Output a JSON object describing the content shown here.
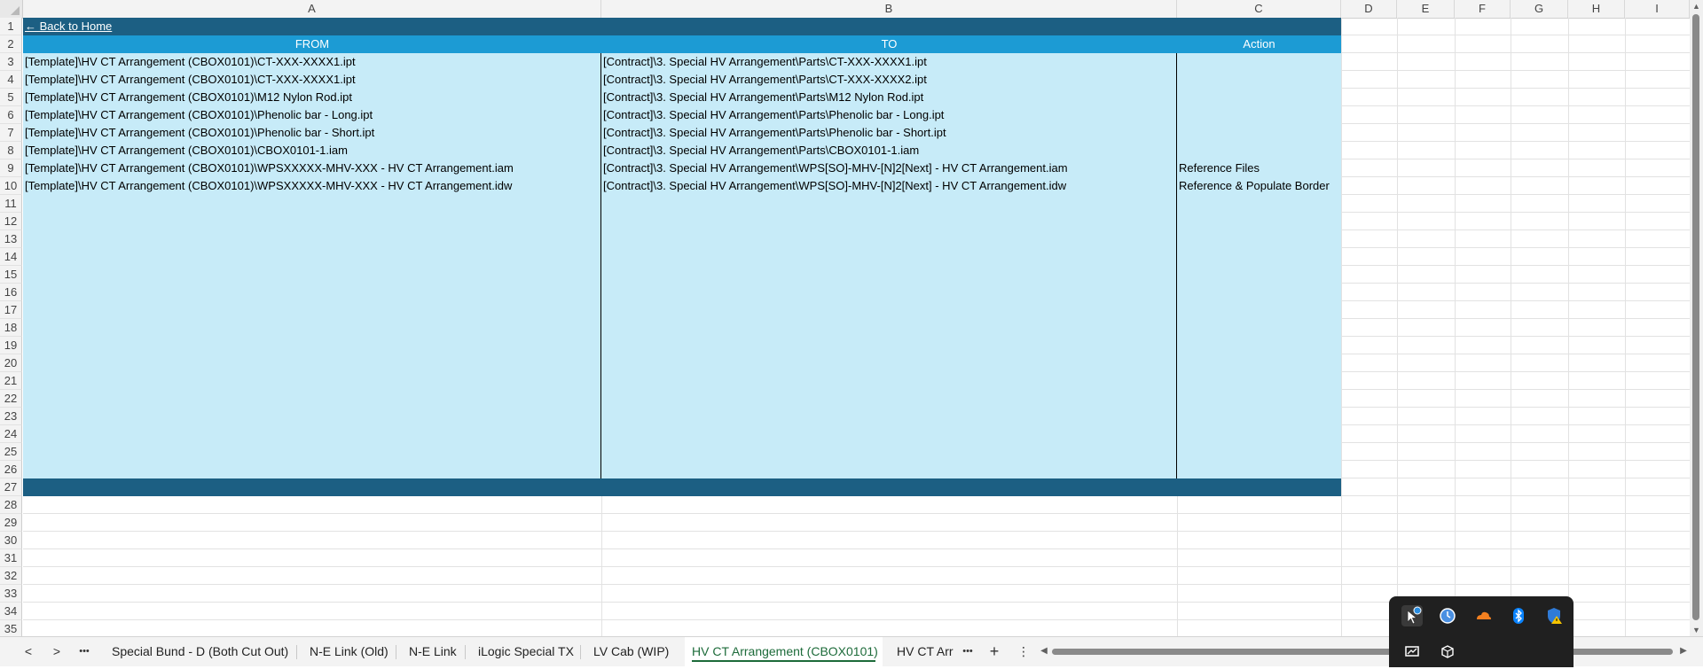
{
  "columns": [
    "A",
    "B",
    "C",
    "D",
    "E",
    "F",
    "G",
    "H",
    "I"
  ],
  "rows": [
    "1",
    "2",
    "3",
    "4",
    "5",
    "6",
    "7",
    "8",
    "9",
    "10",
    "11",
    "12",
    "13",
    "14",
    "15",
    "16",
    "17",
    "18",
    "19",
    "20",
    "21",
    "22",
    "23",
    "24",
    "25",
    "26",
    "27",
    "28",
    "29",
    "30",
    "31",
    "32",
    "33",
    "34",
    "35"
  ],
  "back_link": "← Back to Home",
  "headers": {
    "from": "FROM",
    "to": "TO",
    "action": "Action"
  },
  "table_rows": [
    {
      "from": "[Template]\\HV CT Arrangement (CBOX0101)\\CT-XXX-XXXX1.ipt",
      "to": "[Contract]\\3. Special HV Arrangement\\Parts\\CT-XXX-XXXX1.ipt",
      "action": ""
    },
    {
      "from": "[Template]\\HV CT Arrangement (CBOX0101)\\CT-XXX-XXXX1.ipt",
      "to": "[Contract]\\3. Special HV Arrangement\\Parts\\CT-XXX-XXXX2.ipt",
      "action": ""
    },
    {
      "from": "[Template]\\HV CT Arrangement (CBOX0101)\\M12 Nylon Rod.ipt",
      "to": "[Contract]\\3. Special HV Arrangement\\Parts\\M12 Nylon Rod.ipt",
      "action": ""
    },
    {
      "from": "[Template]\\HV CT Arrangement (CBOX0101)\\Phenolic bar - Long.ipt",
      "to": "[Contract]\\3. Special HV Arrangement\\Parts\\Phenolic bar - Long.ipt",
      "action": ""
    },
    {
      "from": "[Template]\\HV CT Arrangement (CBOX0101)\\Phenolic bar - Short.ipt",
      "to": "[Contract]\\3. Special HV Arrangement\\Parts\\Phenolic bar - Short.ipt",
      "action": ""
    },
    {
      "from": "[Template]\\HV CT Arrangement (CBOX0101)\\CBOX0101-1.iam",
      "to": "[Contract]\\3. Special HV Arrangement\\Parts\\CBOX0101-1.iam",
      "action": ""
    },
    {
      "from": "[Template]\\HV CT Arrangement (CBOX0101)\\WPSXXXXX-MHV-XXX - HV CT Arrangement.iam",
      "to": "[Contract]\\3. Special HV Arrangement\\WPS[SO]-MHV-[N]2[Next] - HV CT Arrangement.iam",
      "action": "Reference Files"
    },
    {
      "from": "[Template]\\HV CT Arrangement (CBOX0101)\\WPSXXXXX-MHV-XXX - HV CT Arrangement.idw",
      "to": "[Contract]\\3. Special HV Arrangement\\WPS[SO]-MHV-[N]2[Next] - HV CT Arrangement.idw",
      "action": "Reference & Populate Border"
    }
  ],
  "tabs": [
    {
      "label": "Special Bund - D (Both Cut Out)",
      "active": false
    },
    {
      "label": "N-E Link (Old)",
      "active": false
    },
    {
      "label": "N-E Link",
      "active": false
    },
    {
      "label": "iLogic Special TX",
      "active": false
    },
    {
      "label": "LV Cab (WIP)",
      "active": false
    },
    {
      "label": "HV CT Arrangement (CBOX0101)",
      "active": true
    },
    {
      "label": "HV CT Arr",
      "active": false
    }
  ],
  "tab_nav": {
    "prev": "<",
    "next": ">",
    "more_left": "•••",
    "more_right": "•••",
    "add": "+",
    "options": "⋮"
  },
  "tray_icons": [
    "person-cursor-icon",
    "browser-icon",
    "cloud-icon",
    "bluetooth-icon",
    "security-warning-icon",
    "display-icon",
    "box-icon"
  ],
  "colors": {
    "header_bar": "#1c5f83",
    "header_cell": "#1c9bd4",
    "body_fill": "#c7ebf8",
    "active_tab": "#1d6b3a"
  }
}
